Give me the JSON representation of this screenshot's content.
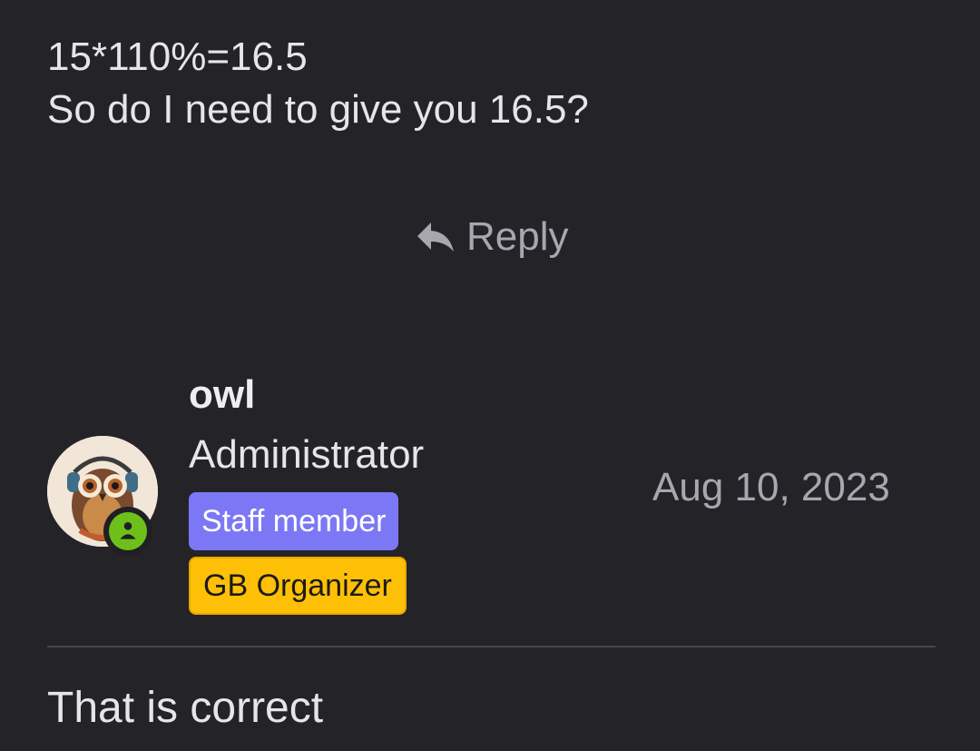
{
  "previous_post": {
    "lines": [
      "15*110%=16.5",
      "So do I need to give you 16.5?"
    ]
  },
  "reply_action": {
    "label": "Reply",
    "icon": "reply-arrow-icon"
  },
  "post": {
    "author": {
      "username": "owl",
      "title": "Administrator",
      "avatar_icon": "owl-avatar",
      "status_icon": "online-user-icon",
      "badges": [
        {
          "label": "Staff member",
          "color": "#7c78f5"
        },
        {
          "label": "GB Organizer",
          "color": "#fec006"
        }
      ]
    },
    "date": "Aug 10, 2023",
    "body": "That is correct"
  },
  "colors": {
    "background": "#232328",
    "muted_text": "#a7a8ae",
    "online_green": "#6fbf1b"
  }
}
